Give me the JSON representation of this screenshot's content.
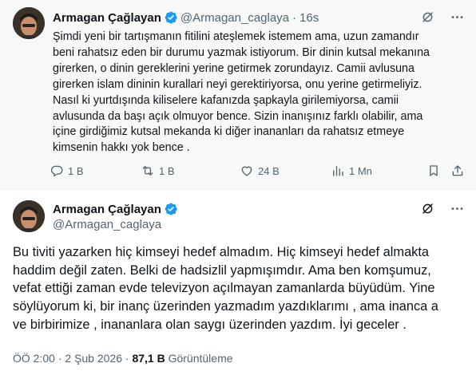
{
  "colors": {
    "verified": "#1d9bf0",
    "text_primary": "#0f1419",
    "text_secondary": "#536471",
    "reply_background": "#f7f9f9"
  },
  "reply_tweet": {
    "author": "Armagan Çağlayan",
    "handle": "@Armagan_caglaya",
    "separator": "·",
    "time": "16s",
    "text": "Şimdi yeni bir tartışmanın fitilini ateşlemek istemem ama, uzun zamandır\nbeni rahatsız eden bir durumu yazmak istiyorum. Bir dinin kutsal mekanına\ngirerken, o dinin gereklerini yerine getirmek zorundayız. Camii avlusuna\ngirerken islam dininin kurallari neyi gerektiriyorsa, onu yerine getirmeliyiz.\nNasıl ki yurtdışında kiliselere kafanızda şapkayla girilemiyorsa, camii\navlusunda da başı açık olmuyor bence. Sizin inanışınız farklı olabilir, ama\niçine girdiğimiz kutsal mekanda ki diğer inananları da rahatsız etmeye\nkimsenin hakkı yok bence .",
    "icons": [
      "grok-icon",
      "more-icon"
    ],
    "actions": {
      "replies": "1 B",
      "reposts": "1 B",
      "likes": "24 B",
      "views": "1 Mn"
    }
  },
  "main_tweet": {
    "author": "Armagan Çağlayan",
    "handle": "@Armagan_caglaya",
    "text": "Bu tiviti yazarken hiç kimseyi hedef almadım. Hiç kimseyi hedef almakta\nhaddim değil zaten. Belki de hadsizlil yapmışımdır. Ama ben komşumuz,\nvefat ettiği zaman evde televizyon açılmayan zamanlarda büyüdüm. Yine\nsöylüyorum ki, bir inanç üzerinden yazmadım yazdıklarımı , ama inanca a\nve birbirimize , inananlara olan saygı üzerinden yazdım. İyi geceler .",
    "time": "ÖÖ 2:00",
    "date": "2 Şub 2026",
    "separator": "·",
    "views_count": "87,1 B",
    "views_label": "Görüntüleme",
    "icons": [
      "grok-icon",
      "more-icon"
    ]
  }
}
